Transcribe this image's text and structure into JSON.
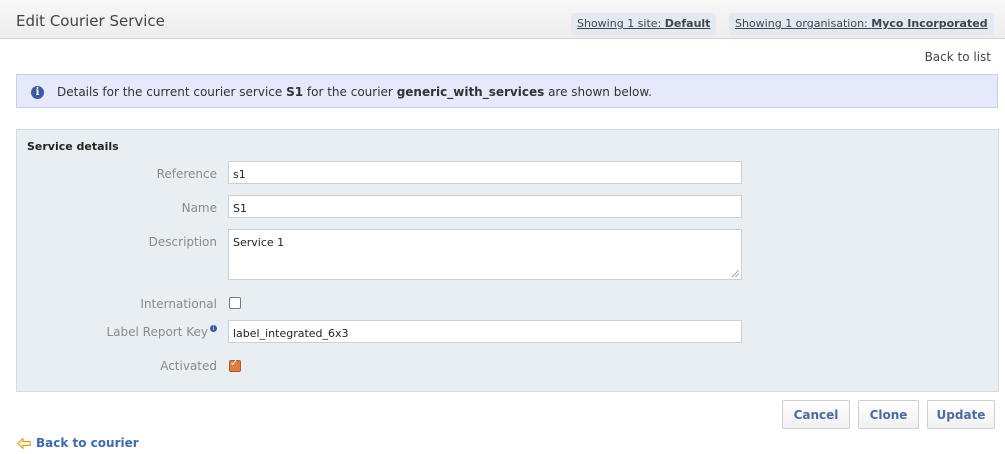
{
  "header": {
    "title": "Edit Courier Service",
    "site_prefix": "Showing 1 site: ",
    "site_name": "Default",
    "org_prefix": "Showing 1 organisation: ",
    "org_name": "Myco Incorporated"
  },
  "nav": {
    "back_to_list": "Back to list"
  },
  "info": {
    "text_1": "Details for the current courier service ",
    "service": "S1",
    "text_2": " for the courier ",
    "courier": "generic_with_services",
    "text_3": " are shown below."
  },
  "panel": {
    "title": "Service details",
    "labels": {
      "reference": "Reference",
      "name": "Name",
      "description": "Description",
      "international": "International",
      "label_report_key": "Label Report Key",
      "activated": "Activated"
    },
    "values": {
      "reference": "s1",
      "name": "S1",
      "description": "Service 1",
      "international": false,
      "label_report_key": "label_integrated_6x3",
      "activated": true
    },
    "help_icon": "info-icon"
  },
  "buttons": {
    "cancel": "Cancel",
    "clone": "Clone",
    "update": "Update"
  },
  "footer": {
    "back_to_courier": "Back to courier",
    "back_icon": "arrow-left-icon"
  },
  "colors": {
    "accent": "#3a6ab8",
    "checkbox_checked": "#e07b3a",
    "info_bg": "#e6e9fb",
    "panel_bg": "#e8eef2"
  }
}
